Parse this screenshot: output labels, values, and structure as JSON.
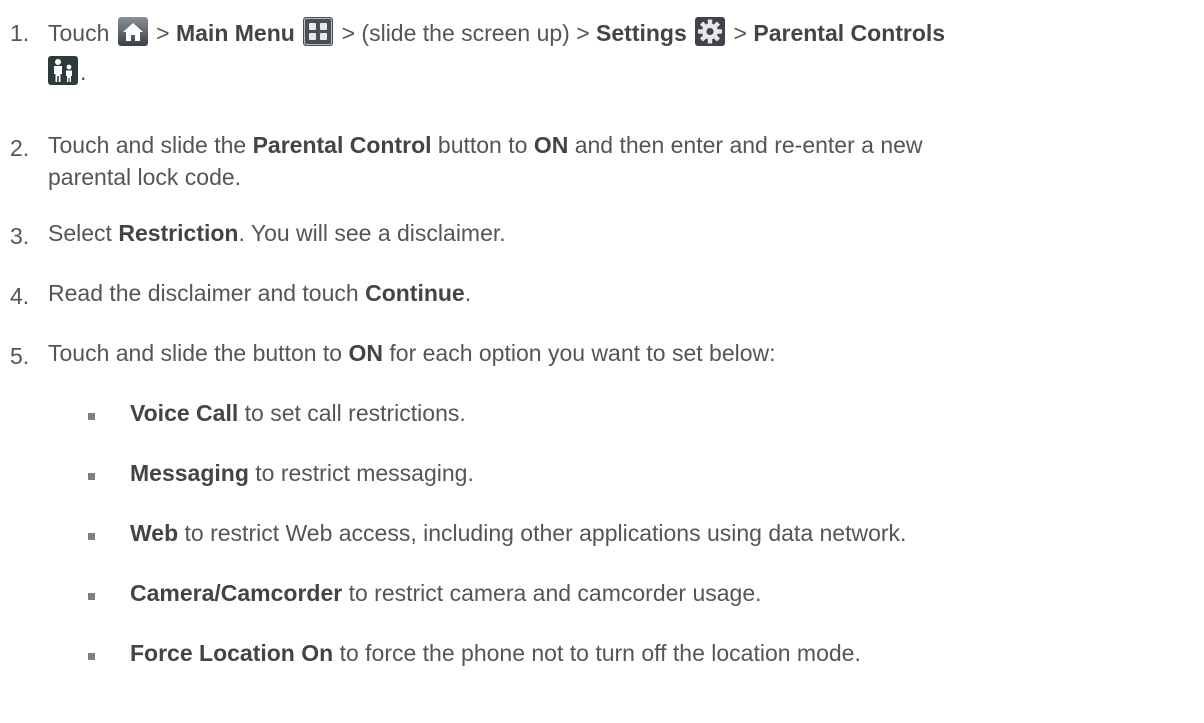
{
  "steps": [
    {
      "number": "1.",
      "p1": "Touch ",
      "p2": " > ",
      "main_menu": "Main Menu",
      "p3": " > (slide the screen up) > ",
      "settings": "Settings",
      "p4": " > ",
      "parental_controls": "Parental Controls",
      "p5": "."
    },
    {
      "number": "2.",
      "p1": "Touch and slide the ",
      "parental_control": "Parental Control",
      "p2": " button to ",
      "on": "ON",
      "p3": " and then enter and re-enter a new",
      "line2": "parental lock code."
    },
    {
      "number": "3.",
      "p1": "Select ",
      "restriction": "Restriction",
      "p2": ". You will see a disclaimer."
    },
    {
      "number": "4.",
      "p1": "Read the disclaimer and touch ",
      "continue": "Continue",
      "p2": "."
    },
    {
      "number": "5.",
      "p1": "Touch and slide the button to ",
      "on": "ON",
      "p2": " for each option you want to set below:"
    }
  ],
  "options": [
    {
      "label": "Voice Call",
      "desc": " to set call restrictions."
    },
    {
      "label": "Messaging",
      "desc": " to restrict messaging."
    },
    {
      "label": "Web",
      "desc": " to restrict Web access, including other applications using data network."
    },
    {
      "label": "Camera/Camcorder",
      "desc": " to restrict camera and camcorder usage."
    },
    {
      "label": "Force Location On",
      "desc": " to force the phone not to turn off the location mode."
    }
  ],
  "icons": [
    "home-icon",
    "main-menu-icon",
    "settings-gear-icon",
    "parental-controls-icon"
  ]
}
